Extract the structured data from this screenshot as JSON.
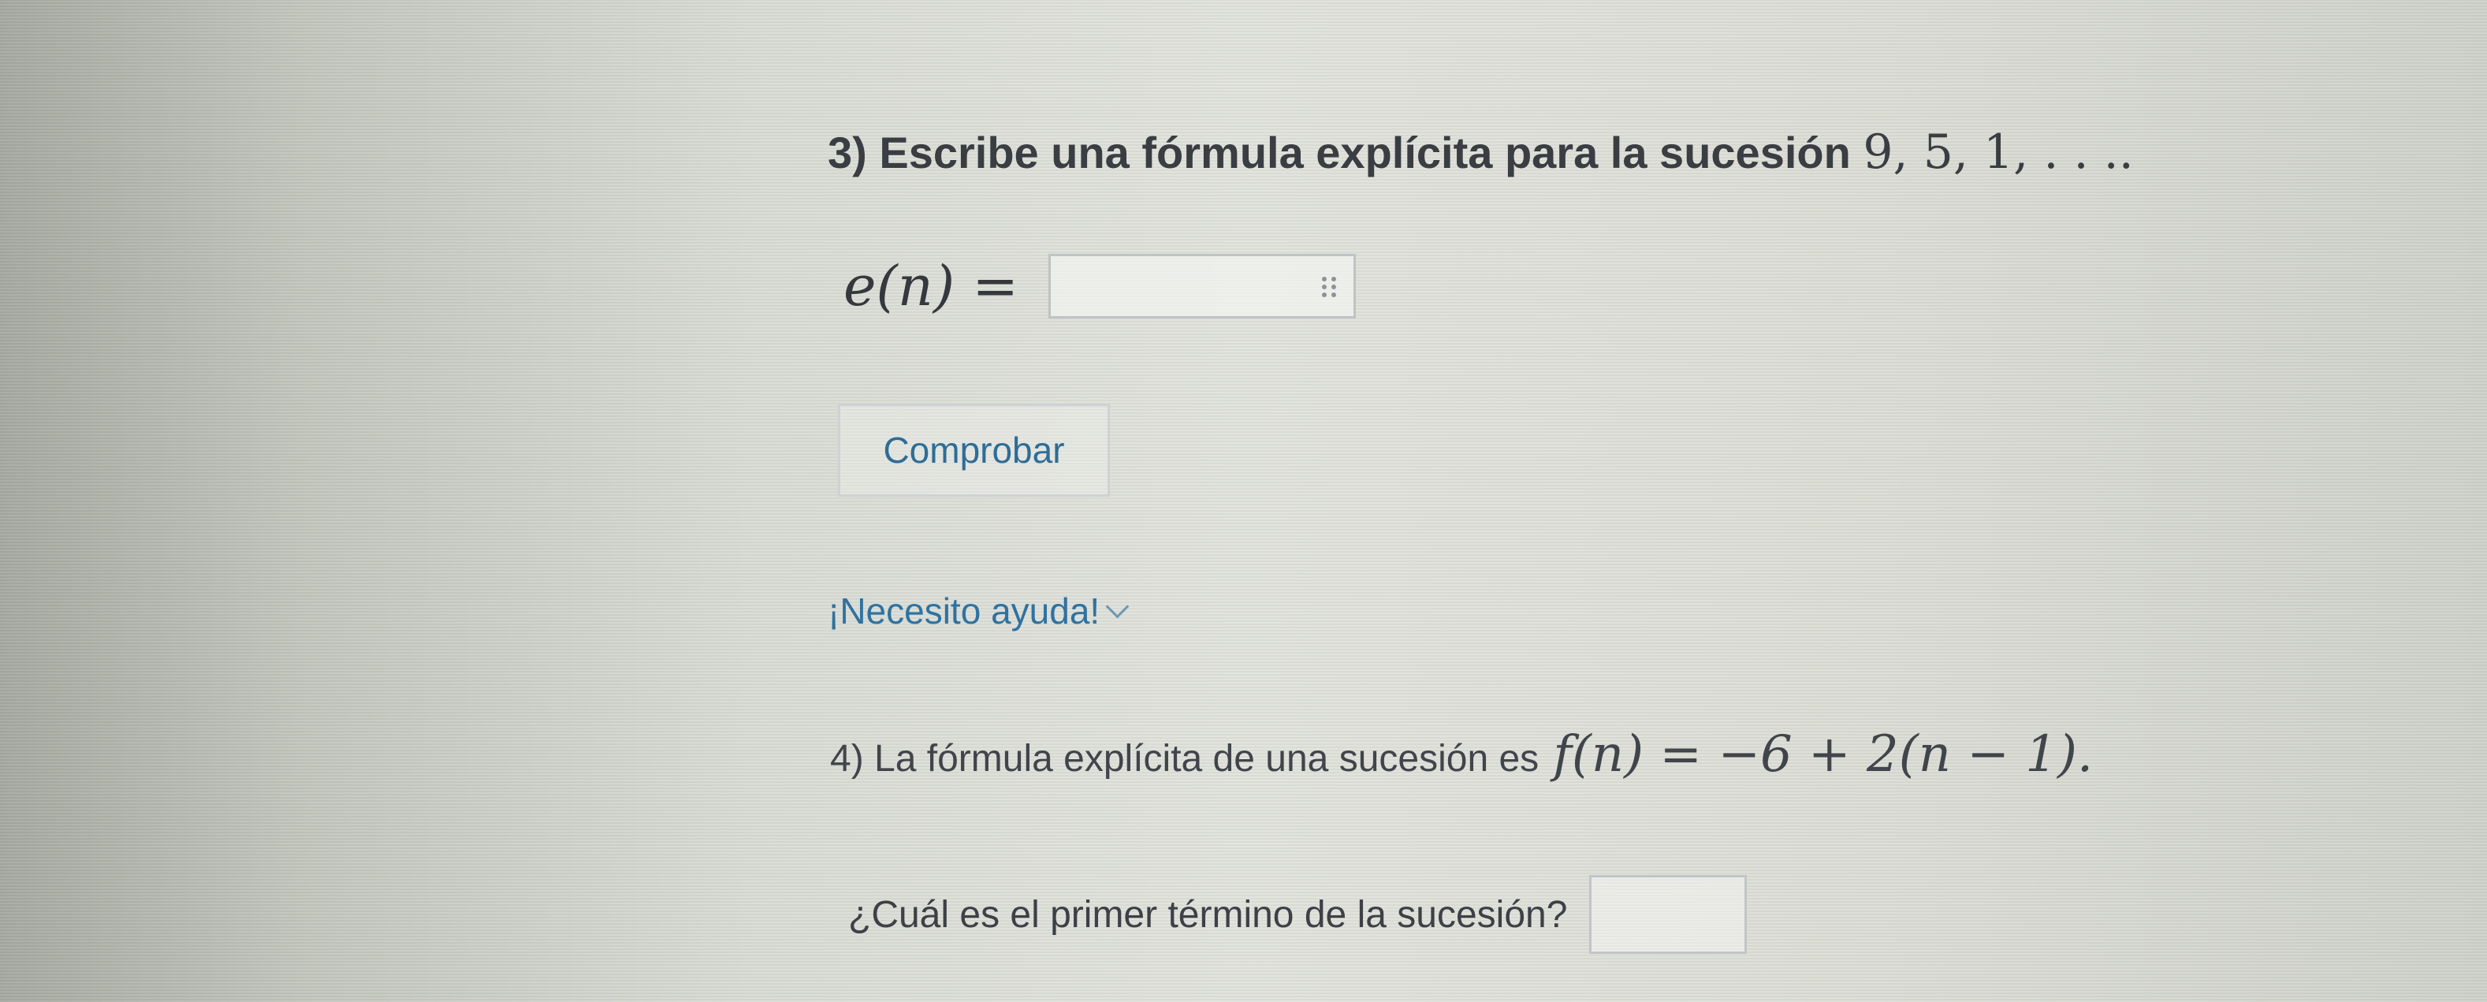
{
  "question3": {
    "title_text": "3) Escribe una fórmula explícita para la sucesión ",
    "sequence": "9, 5, 1, . . ..",
    "formula_label": "e(n) =",
    "answer_value": "",
    "check_button_label": "Comprobar",
    "help_label": "¡Necesito ayuda!"
  },
  "question4": {
    "statement_text": "4) La fórmula explícita de una sucesión es",
    "formula": "f(n) = −6 + 2(n − 1).",
    "prompt_text": "¿Cuál es el primer término de la sucesión?",
    "answer_value": ""
  }
}
